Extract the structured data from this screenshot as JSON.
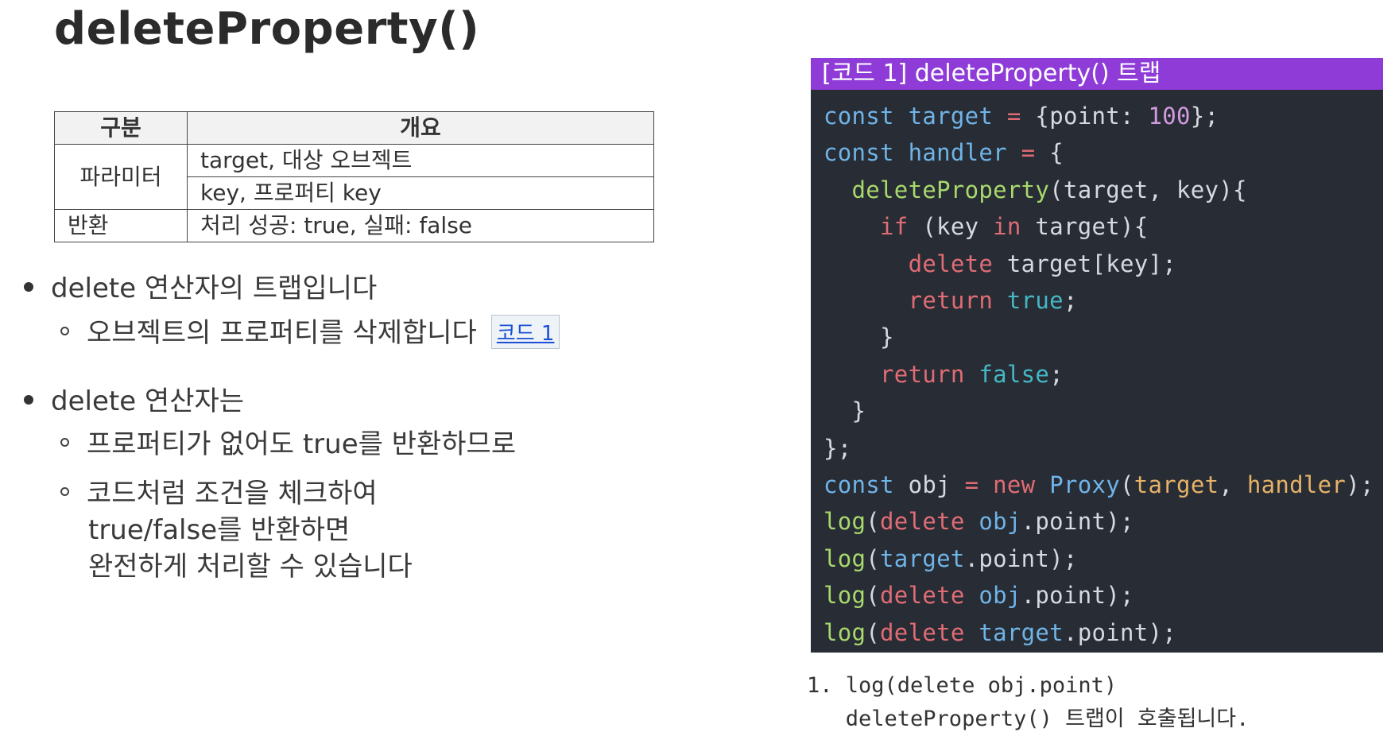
{
  "title": "deleteProperty()",
  "table": {
    "headers": [
      "구분",
      "개요"
    ],
    "param_label": "파라미터",
    "param_rows": [
      "target, 대상 오브젝트",
      "key, 프로퍼티 key"
    ],
    "return_label": "반환",
    "return_value": "처리 성공: true, 실패: false"
  },
  "bullets": {
    "b1": "delete 연산자의 트랩입니다",
    "b1_sub": "오브젝트의 프로퍼티를 삭제합니다",
    "b1_link": "코드 1",
    "b2": "delete 연산자는",
    "b2_sub1": "프로퍼티가 없어도 true를 반환하므로",
    "b2_sub2_line1": "코드처럼 조건을 체크하여",
    "b2_sub2_line2": "true/false를 반환하면",
    "b2_sub2_line3": "완전하게 처리할 수 있습니다"
  },
  "code_panel": {
    "header": "[코드 1] deleteProperty() 트랩"
  },
  "caption": {
    "line1": "1. log(delete obj.point)",
    "line2": "   deleteProperty() 트랩이 호출됩니다."
  }
}
